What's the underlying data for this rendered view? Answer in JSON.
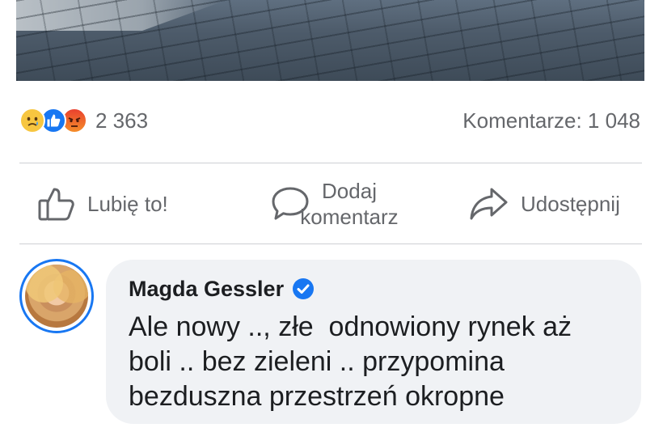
{
  "post": {
    "reactions": {
      "icons": [
        "sad-reaction-icon",
        "like-reaction-icon",
        "angry-reaction-icon"
      ],
      "count": "2 363"
    },
    "comments_count": "Komentarze: 1 048"
  },
  "actions": {
    "like_label": "Lubię to!",
    "comment_label_line1": "Dodaj",
    "comment_label_line2": "komentarz",
    "share_label": "Udostępnij"
  },
  "comment": {
    "author": "Magda Gessler",
    "verified": true,
    "lines": [
      "Ale nowy .., złe  odnowiony rynek aż",
      "boli .. bez zieleni .. przypomina",
      "bezduszna przestrzeń okropne"
    ]
  },
  "colors": {
    "accent": "#1877f2",
    "text_secondary": "#65676b",
    "bubble_bg": "#f0f2f5"
  }
}
